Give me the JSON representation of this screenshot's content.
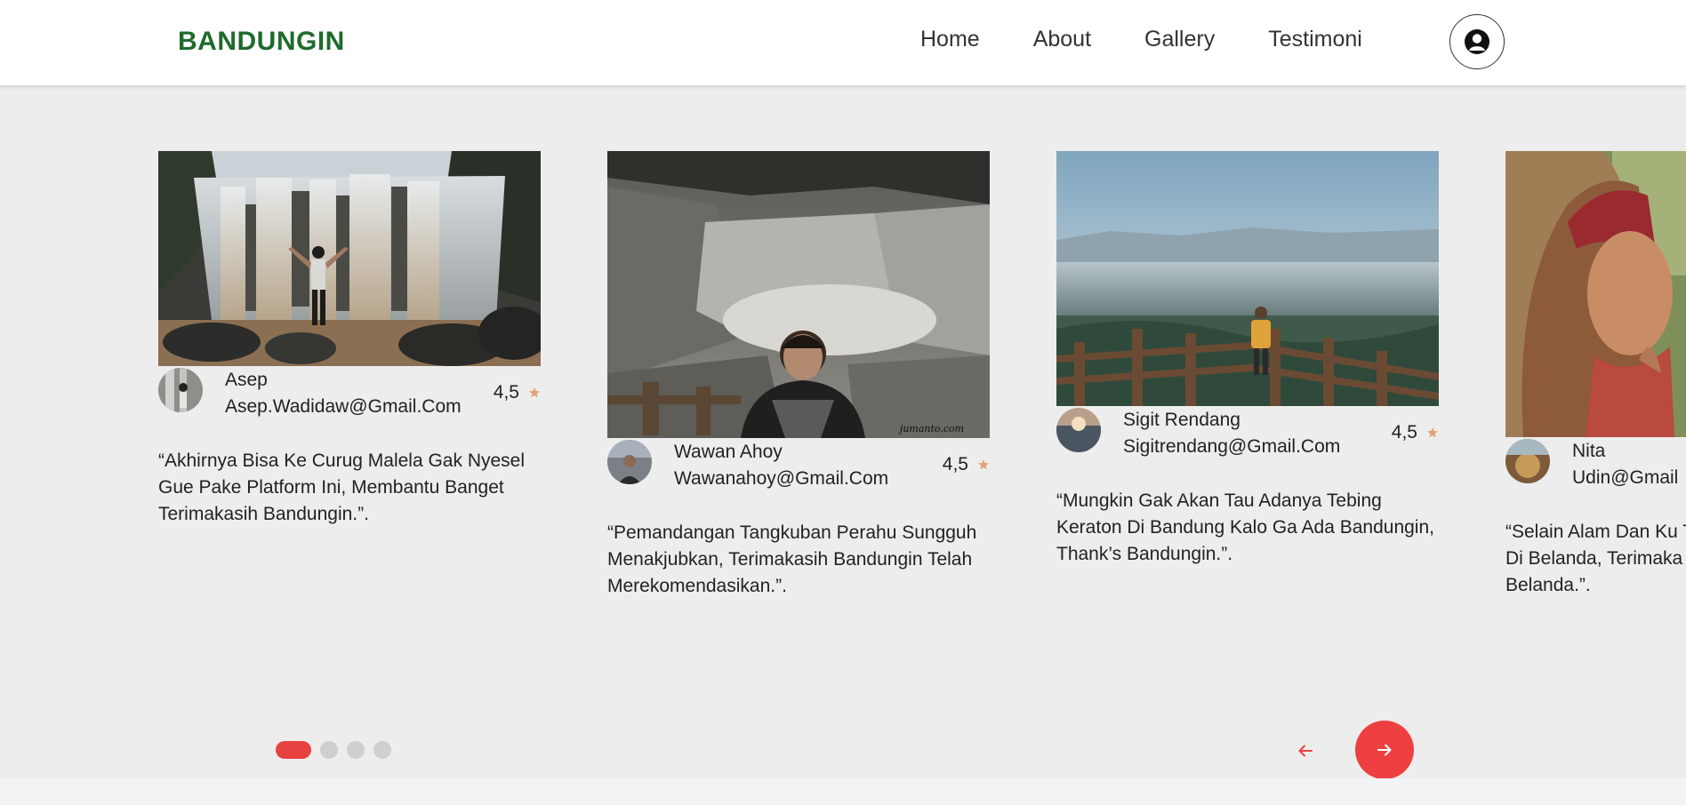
{
  "navbar": {
    "brand": "BANDUNGIN",
    "links": [
      "Home",
      "About",
      "Gallery",
      "Testimoni"
    ]
  },
  "testimonials": [
    {
      "name": "Asep",
      "email": "Asep.Wadidaw@Gmail.Com",
      "rating": "4,5",
      "quote": "“Akhirnya Bisa Ke Curug Malela Gak Nyesel Gue Pake Platform Ini, Membantu Banget Terimakasih Bandungin.”."
    },
    {
      "name": "Wawan Ahoy",
      "email": "Wawanahoy@Gmail.Com",
      "rating": "4,5",
      "quote": "“Pemandangan Tangkuban Perahu Sungguh Menakjubkan, Terimakasih Bandungin Telah Merekomendasikan.”.",
      "watermark": "jumanto.com"
    },
    {
      "name": "Sigit Rendang",
      "email": "Sigitrendang@Gmail.Com",
      "rating": "4,5",
      "quote": "“Mungkin Gak Akan Tau Adanya Tebing Keraton Di Bandung Kalo Ga Ada Bandungin, Thank’s Bandungin.”."
    },
    {
      "name": "Nita",
      "email": "Udin@Gmail",
      "rating": "",
      "quote": "“Selain Alam Dan Ku Ternyata Gue Bisa Ng Di Belanda, Terimaka Merekomendasiakn Belanda.”."
    }
  ],
  "carousel": {
    "page_count": 4,
    "active_page": 1
  },
  "colors": {
    "brand": "#1e6b2c",
    "accent": "#ee4040",
    "star": "#e0a37a",
    "section_bg": "#ededed"
  },
  "icons": {
    "profile": "user-circle-icon",
    "star": "star-icon",
    "prev": "arrow-left-icon",
    "next": "arrow-right-icon"
  }
}
